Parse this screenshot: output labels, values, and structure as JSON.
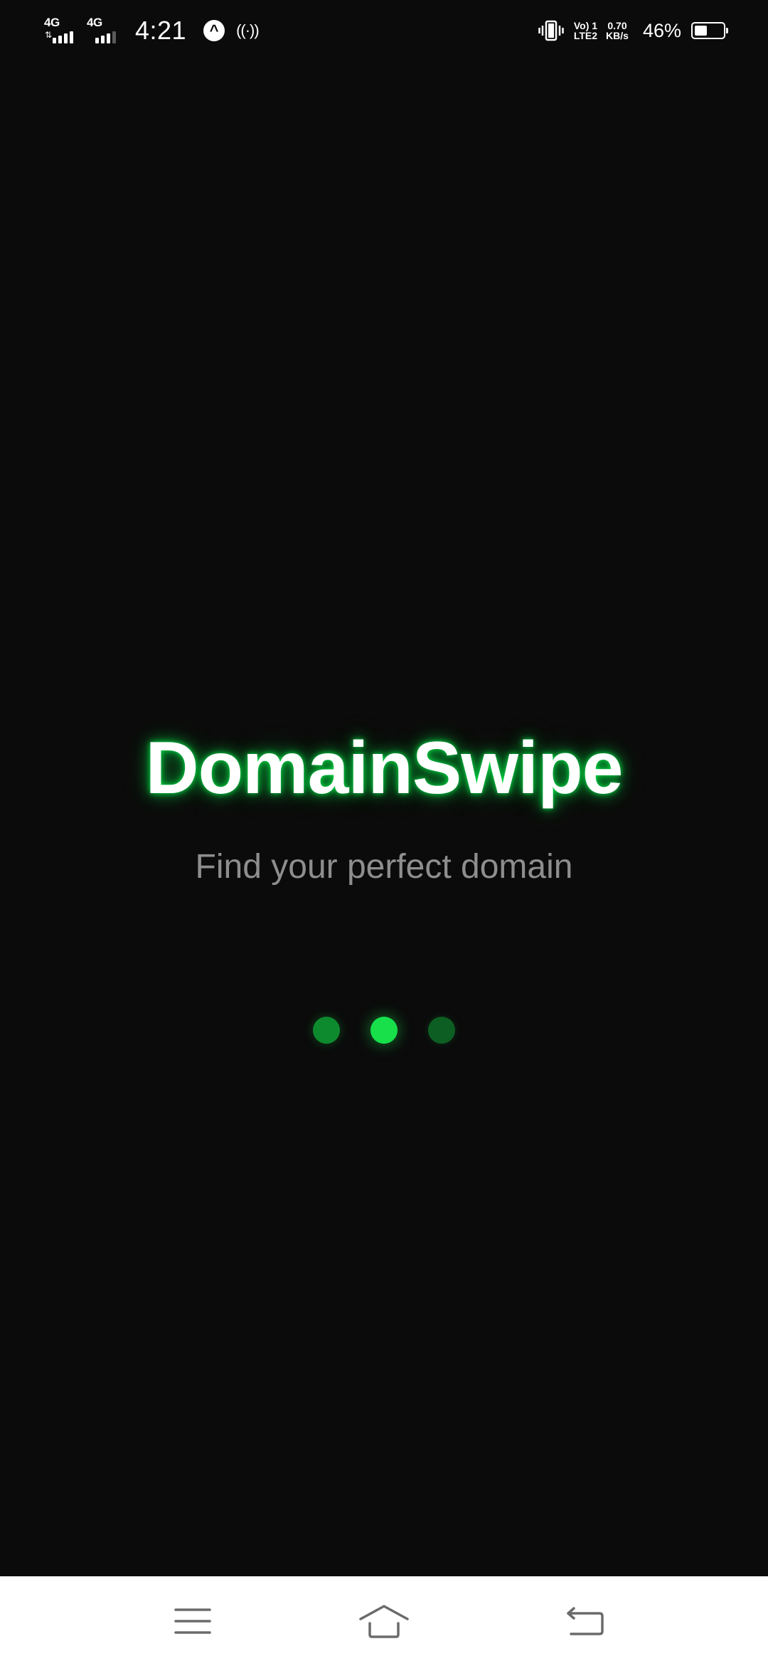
{
  "status_bar": {
    "sim1_network": "4G",
    "sim1_signal_bars": 4,
    "sim2_network": "4G",
    "sim2_signal_bars": 3,
    "time": "4:21",
    "volte_line1": "Vo) 1",
    "volte_line2": "LTE2",
    "speed_value": "0.70",
    "speed_unit": "KB/s",
    "battery_percent": "46%",
    "battery_level": 0.46,
    "icons": [
      "signal-icon",
      "signal-icon",
      "a-notification-icon",
      "hotspot-icon",
      "vibrate-icon",
      "battery-icon"
    ]
  },
  "splash": {
    "title": "DomainSwipe",
    "tagline": "Find your perfect domain",
    "loader_active_index": 1,
    "accent_color": "#17e04a"
  },
  "nav_bar": {
    "buttons": [
      "menu-icon",
      "home-icon",
      "back-icon"
    ]
  }
}
